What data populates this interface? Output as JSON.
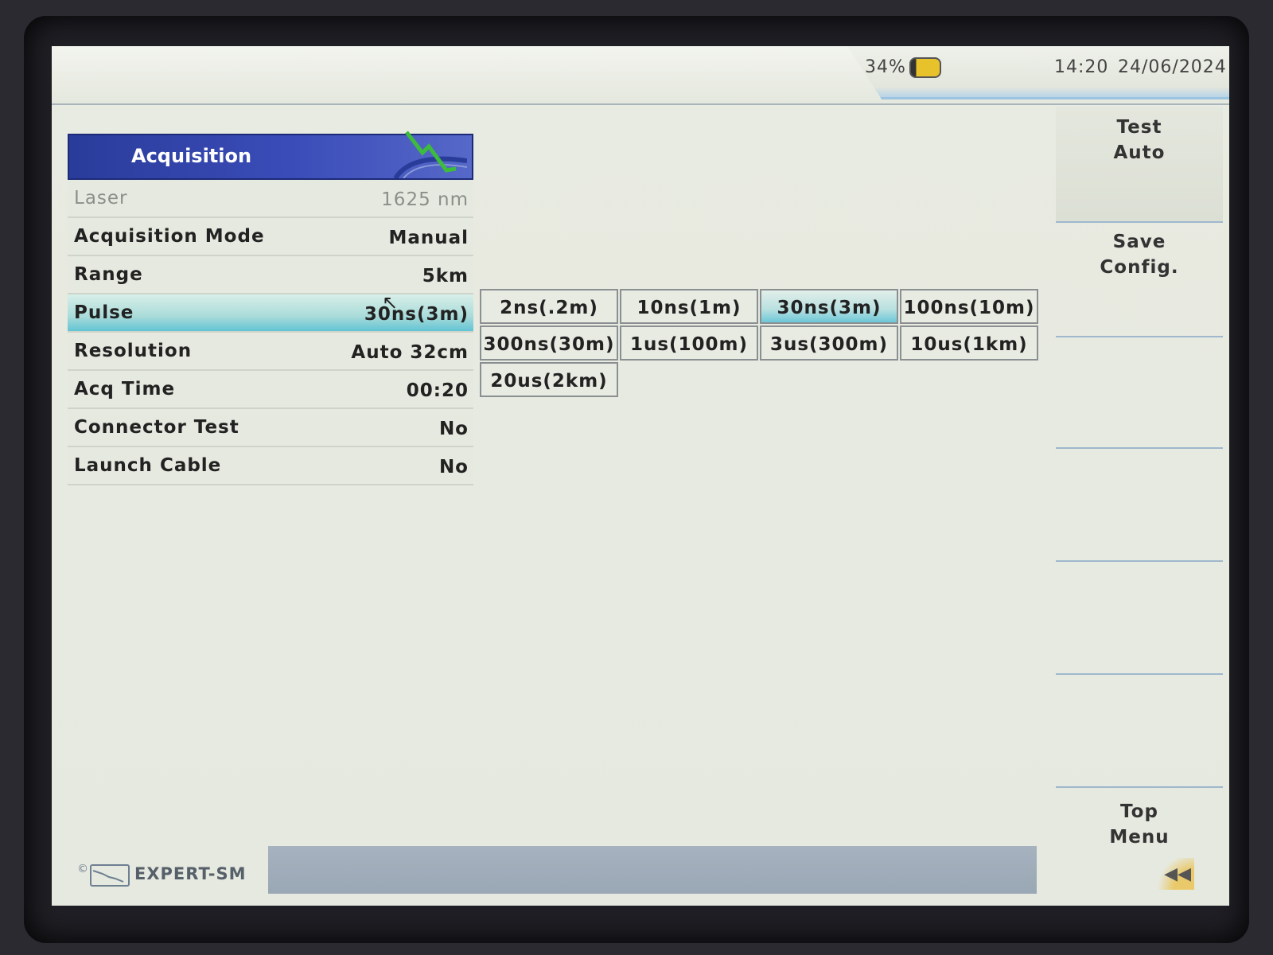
{
  "status": {
    "battery_percent": "34%",
    "time": "14:20",
    "date": "24/06/2024"
  },
  "panel": {
    "title": "Acquisition",
    "rows": [
      {
        "label": "Laser",
        "value": "1625 nm"
      },
      {
        "label": "Acquisition Mode",
        "value": "Manual"
      },
      {
        "label": "Range",
        "value": "5km"
      },
      {
        "label": "Pulse",
        "value": "30ns(3m)"
      },
      {
        "label": "Resolution",
        "value": "Auto 32cm"
      },
      {
        "label": "Acq Time",
        "value": "00:20"
      },
      {
        "label": "Connector Test",
        "value": "No"
      },
      {
        "label": "Launch Cable",
        "value": "No"
      }
    ]
  },
  "pulse_options": [
    "2ns(.2m)",
    "10ns(1m)",
    "30ns(3m)",
    "100ns(10m)",
    "300ns(30m)",
    "1us(100m)",
    "3us(300m)",
    "10us(1km)",
    "20us(2km)"
  ],
  "softkeys": {
    "test_line1": "Test",
    "test_line2": "Auto",
    "save_line1": "Save",
    "save_line2": "Config.",
    "top_line1": "Top",
    "top_line2": "Menu"
  },
  "footer": {
    "mode_label": "EXPERT-SM",
    "copyright": "©"
  },
  "icons": {
    "battery": "battery-icon",
    "trace": "trace-graph-icon",
    "back": "back-arrow-icon"
  }
}
